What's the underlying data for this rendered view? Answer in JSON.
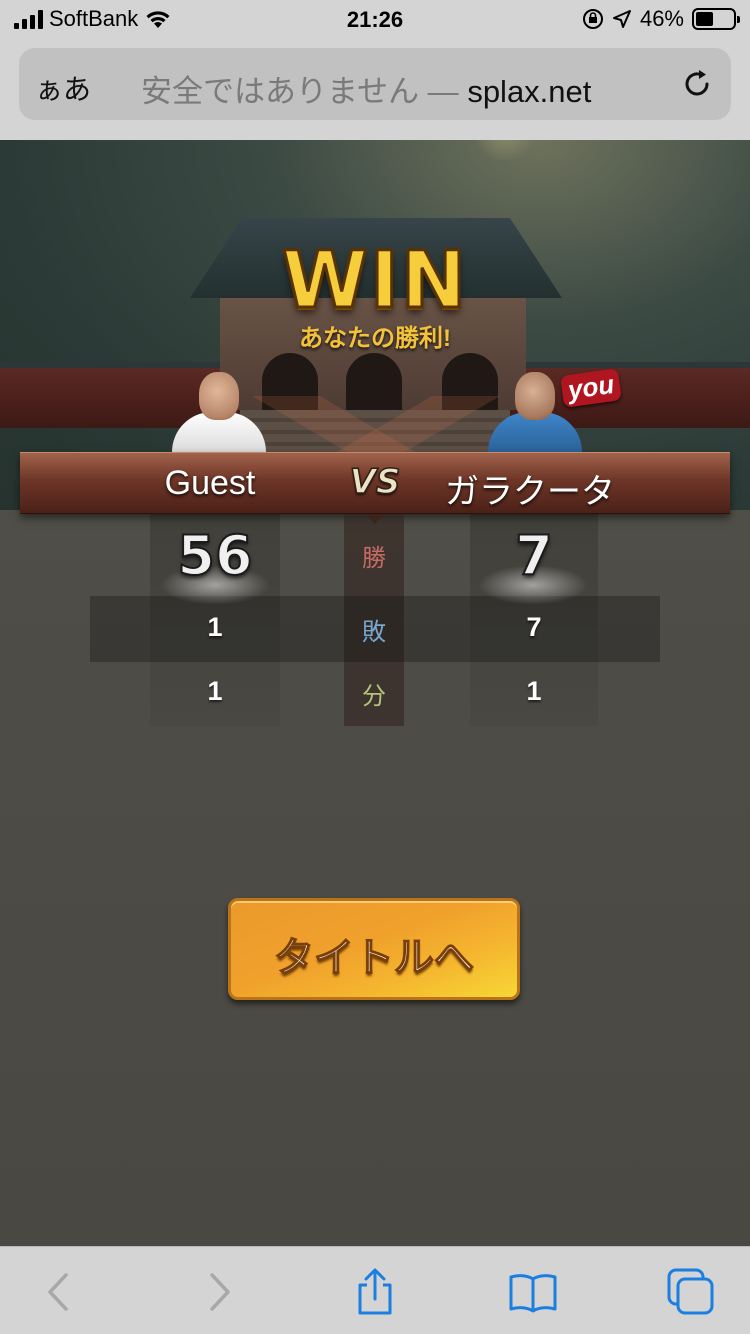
{
  "status_bar": {
    "carrier": "SoftBank",
    "time": "21:26",
    "battery_percent": "46%",
    "battery_level": 0.46
  },
  "browser": {
    "text_size_button": "ぁあ",
    "security_warning": "安全ではありません —",
    "host": "splax.net"
  },
  "result": {
    "title": "WIN",
    "subtitle": "あなたの勝利!",
    "vs_label": "VS",
    "you_tag": "you",
    "left_player": {
      "name": "Guest",
      "wins": "56",
      "losses": "1",
      "draws": "1"
    },
    "right_player": {
      "name": "ガラクータ",
      "wins": "7",
      "losses": "7",
      "draws": "1"
    },
    "labels": {
      "wins": "勝",
      "losses": "敗",
      "draws": "分"
    }
  },
  "actions": {
    "to_title": "タイトルへ"
  },
  "colors": {
    "win_gold": "#f6cd3a",
    "button_orange": "#f0a12c",
    "toolbar_blue": "#1a7fe0"
  }
}
